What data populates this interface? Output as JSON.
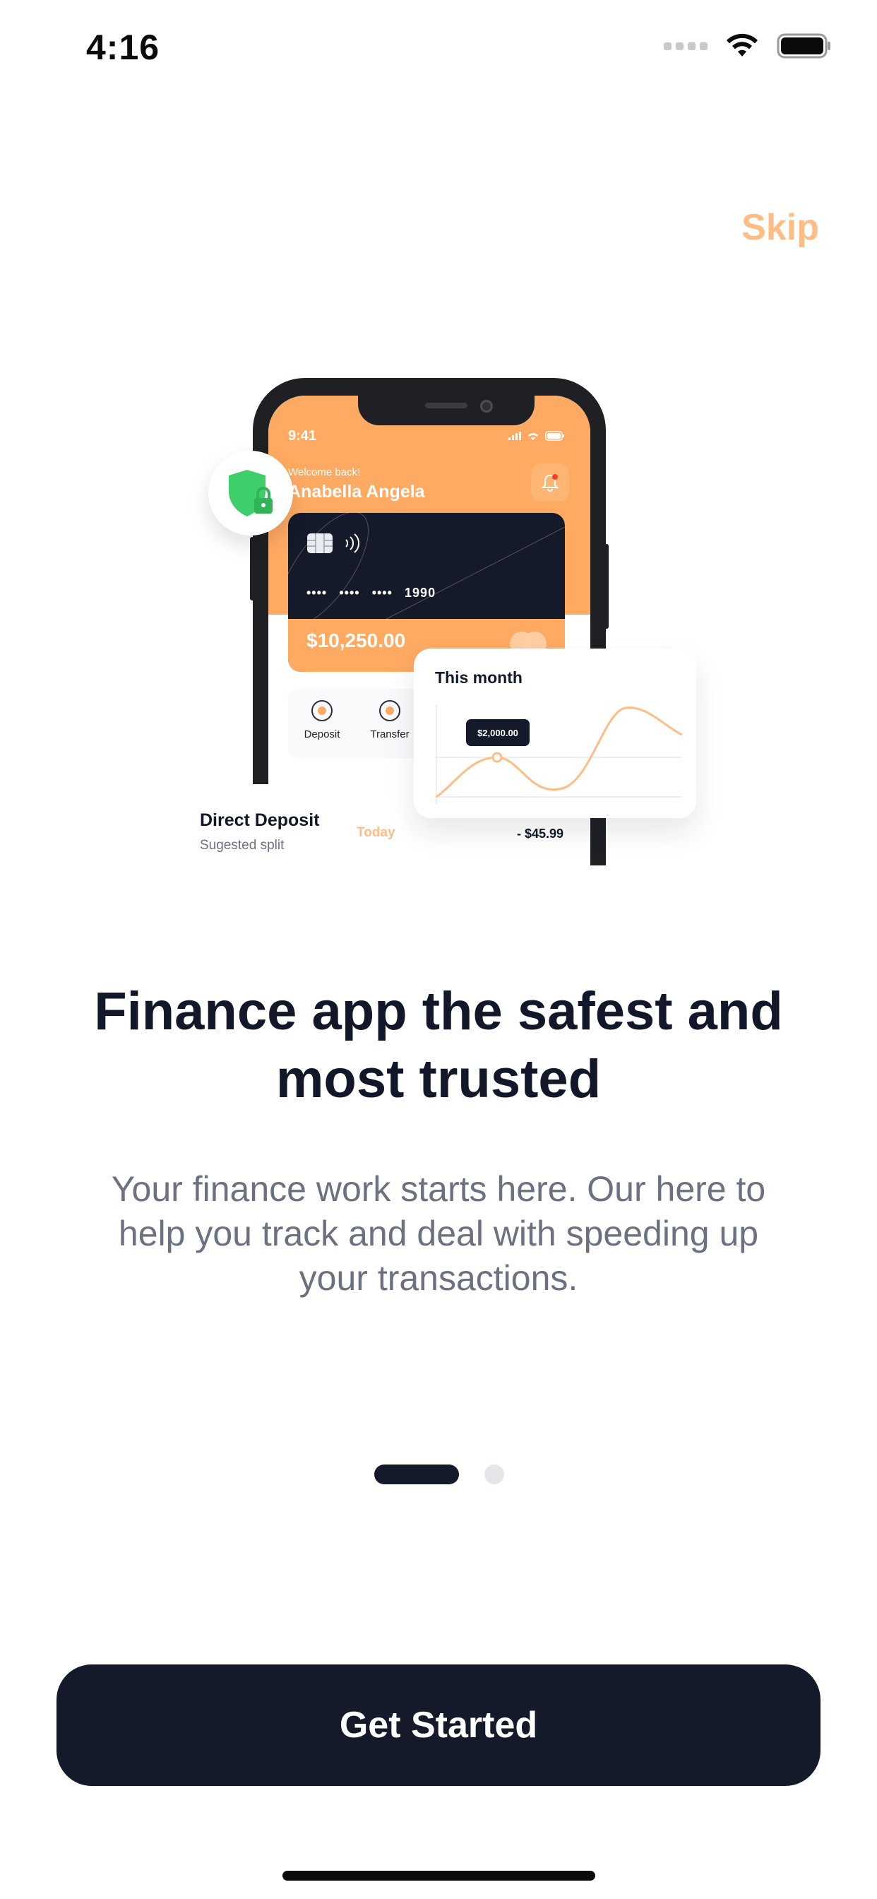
{
  "status_bar": {
    "time": "4:16"
  },
  "header": {
    "skip_label": "Skip"
  },
  "illustration": {
    "phone_time": "9:41",
    "welcome_text": "Welcome back!",
    "user_name": "Anabella Angela",
    "card": {
      "masked_groups": [
        "••••",
        "••••",
        "••••"
      ],
      "last_digits": "1990",
      "balance": "$10,250.00"
    },
    "actions": [
      {
        "label": "Deposit"
      },
      {
        "label": "Transfer"
      }
    ],
    "chart_card": {
      "title": "This month",
      "tooltip": "$2,000.00"
    },
    "deposit": {
      "title": "Direct Deposit",
      "subtitle": "Sugested split",
      "date": "Today",
      "amount": "- $45.99"
    }
  },
  "onboarding": {
    "headline": "Finance app the safest and most trusted",
    "description": "Your finance work starts here. Our here to help you track and deal with speeding up your transactions.",
    "pages_total": 2,
    "active_page": 1
  },
  "cta": {
    "label": "Get Started"
  },
  "colors": {
    "accent": "#ffaa63",
    "skip": "#ffbd86",
    "dark": "#141a2a",
    "shield": "#3ecf6a"
  },
  "icons": [
    "wifi-icon",
    "battery-icon",
    "shield-lock-icon",
    "bell-icon",
    "card-chip-icon",
    "nfc-icon",
    "card-brand-icon",
    "deposit-icon",
    "transfer-icon"
  ]
}
